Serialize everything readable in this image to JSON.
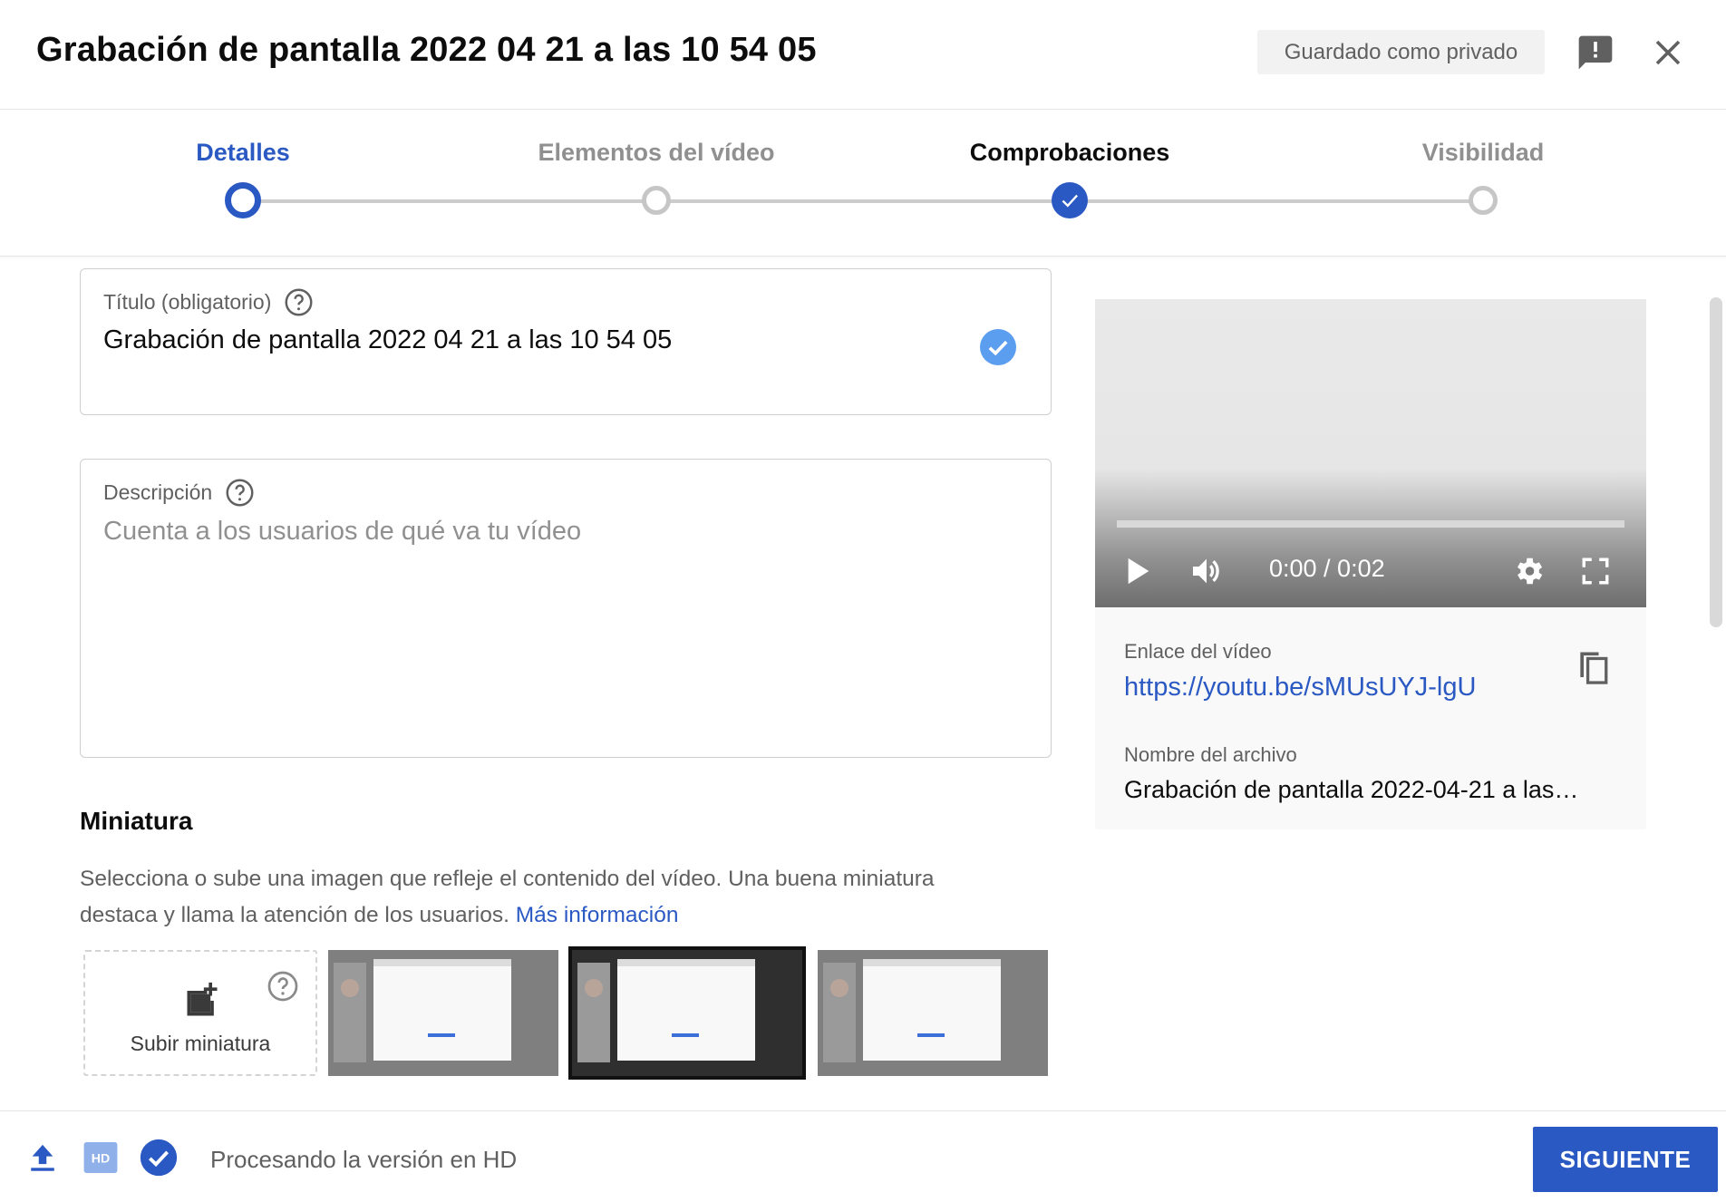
{
  "header": {
    "title": "Grabación de pantalla 2022 04 21 a las 10 54 05",
    "saved_status": "Guardado como privado"
  },
  "stepper": {
    "steps": [
      {
        "label": "Detalles",
        "state": "active"
      },
      {
        "label": "Elementos del vídeo",
        "state": "todo"
      },
      {
        "label": "Comprobaciones",
        "state": "done"
      },
      {
        "label": "Visibilidad",
        "state": "todo"
      }
    ]
  },
  "form": {
    "title_field": {
      "label": "Título (obligatorio)",
      "value": "Grabación de pantalla 2022 04 21 a las 10 54 05"
    },
    "description_field": {
      "label": "Descripción",
      "placeholder": "Cuenta a los usuarios de qué va tu vídeo"
    }
  },
  "thumbnail": {
    "heading": "Miniatura",
    "description": "Selecciona o sube una imagen que refleje el contenido del vídeo. Una buena miniatura destaca y llama la atención de los usuarios.",
    "learn_more": "Más información",
    "upload_label": "Subir miniatura",
    "selected_index": 1
  },
  "preview": {
    "time": "0:00 / 0:02",
    "link_label": "Enlace del vídeo",
    "link": "https://youtu.be/sMUsUYJ-lgU",
    "filename_label": "Nombre del archivo",
    "filename": "Grabación de pantalla 2022-04-21 a las…"
  },
  "footer": {
    "status": "Procesando la versión en HD",
    "hd_badge": "HD",
    "next_label": "SIGUIENTE"
  },
  "colors": {
    "accent": "#2b59c3",
    "check_light": "#5b9ef0",
    "muted_text": "#606060"
  }
}
